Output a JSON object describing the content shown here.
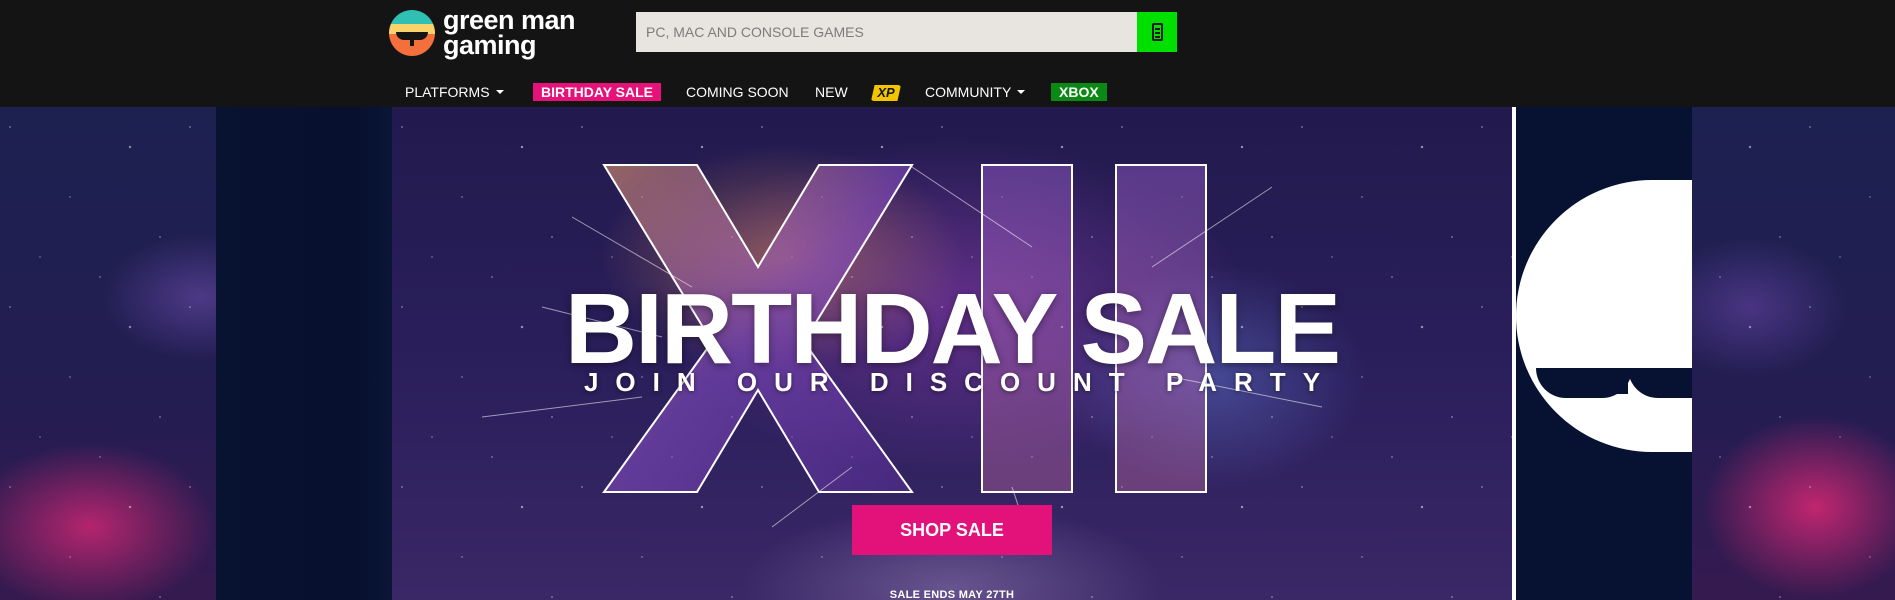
{
  "header": {
    "logo_line1": "green man",
    "logo_line2": "gaming",
    "search_placeholder": "PC, MAC AND CONSOLE GAMES"
  },
  "nav": {
    "platforms": "PLATFORMS",
    "birthday_sale": "BIRTHDAY SALE",
    "coming_soon": "COMING SOON",
    "new": "NEW",
    "xp": "XP",
    "community": "COMMUNITY",
    "xbox": "XBOX"
  },
  "hero": {
    "title": "BIRTHDAY SALE",
    "subtitle": "JOIN OUR DISCOUNT PARTY",
    "numeral": "XII",
    "cta": "SHOP SALE",
    "footnote": "SALE ENDS MAY 27TH"
  },
  "colors": {
    "accent_green": "#00e000",
    "accent_pink": "#e3127a",
    "xbox_green": "#0a8a14",
    "xp_yellow": "#f2c500"
  }
}
